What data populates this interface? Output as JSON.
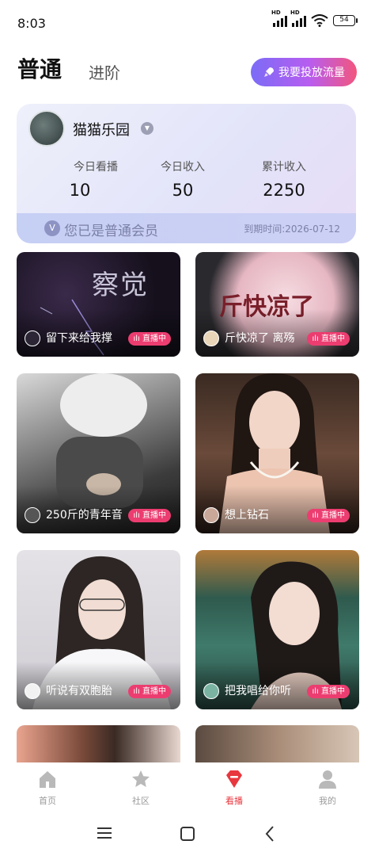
{
  "status_bar": {
    "time": "8:03",
    "signal1_label": "HD",
    "signal2_label": "HD",
    "battery": "54"
  },
  "header": {
    "tab_normal": "普通",
    "tab_advanced": "进阶",
    "boost_button": "我要投放流量",
    "boost_icon": "rocket-icon"
  },
  "member_card": {
    "name": "猫猫乐园",
    "stats": [
      {
        "label": "今日看播",
        "value": "10"
      },
      {
        "label": "今日收入",
        "value": "50"
      },
      {
        "label": "累计收入",
        "value": "2250"
      }
    ],
    "member_status": "您已是普通会员",
    "expiry": "到期时间:2026-07-12"
  },
  "live_badge": "直播中",
  "live_rooms": [
    {
      "title": "留下来给我撑",
      "cover_text": "察觉"
    },
    {
      "title": "斤快凉了 离殇",
      "cover_text": "斤快凉了"
    },
    {
      "title": "250斤的青年音"
    },
    {
      "title": "想上钻石"
    },
    {
      "title": "听说有双胞胎"
    },
    {
      "title": "把我唱给你听"
    }
  ],
  "bottom_nav": [
    {
      "label": "首页",
      "icon": "home-icon"
    },
    {
      "label": "社区",
      "icon": "star-icon"
    },
    {
      "label": "看播",
      "icon": "live-gem-icon",
      "active": true
    },
    {
      "label": "我的",
      "icon": "person-icon"
    }
  ],
  "colors": {
    "accent": "#ec3d70",
    "active_nav": "#e8373e",
    "boost_gradient_start": "#7b6cf6",
    "boost_gradient_end": "#f2567e"
  }
}
